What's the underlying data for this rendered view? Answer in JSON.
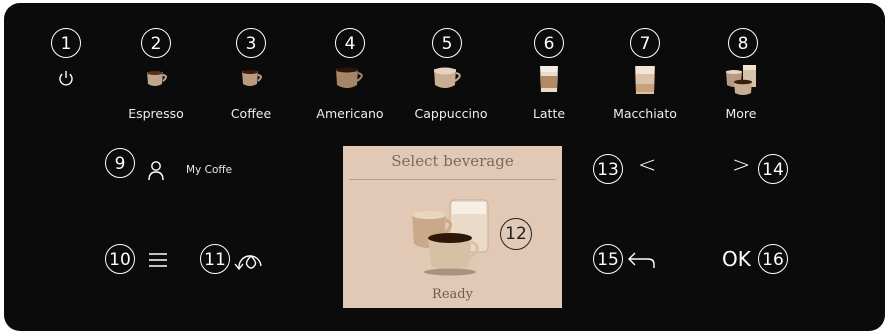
{
  "colors": {
    "panel": "#0b0b0b",
    "foreground": "#ffffff",
    "screen": "#e2c9b6"
  },
  "callouts": [
    "1",
    "2",
    "3",
    "4",
    "5",
    "6",
    "7",
    "8",
    "9",
    "10",
    "11",
    "12",
    "13",
    "14",
    "15",
    "16"
  ],
  "drinks": [
    {
      "label": "Espresso",
      "icon": "espresso-cup-icon"
    },
    {
      "label": "Coffee",
      "icon": "coffee-cup-icon"
    },
    {
      "label": "Americano",
      "icon": "americano-cup-icon"
    },
    {
      "label": "Cappuccino",
      "icon": "cappuccino-cup-icon"
    },
    {
      "label": "Latte",
      "icon": "latte-glass-icon"
    },
    {
      "label": "Macchiato",
      "icon": "macchiato-glass-icon"
    },
    {
      "label": "More",
      "icon": "more-beverages-icon"
    }
  ],
  "profile": {
    "label": "My Coffe",
    "icon": "user-icon"
  },
  "display": {
    "title": "Select beverage",
    "status": "Ready",
    "icon": "beverages-icon"
  },
  "nav": {
    "prev": "<",
    "next": ">",
    "ok": "OK",
    "back_icon": "back-arrow-icon"
  },
  "icons": {
    "power": "power-icon",
    "menu": "menu-icon",
    "maintenance": "aquaclean-icon"
  }
}
